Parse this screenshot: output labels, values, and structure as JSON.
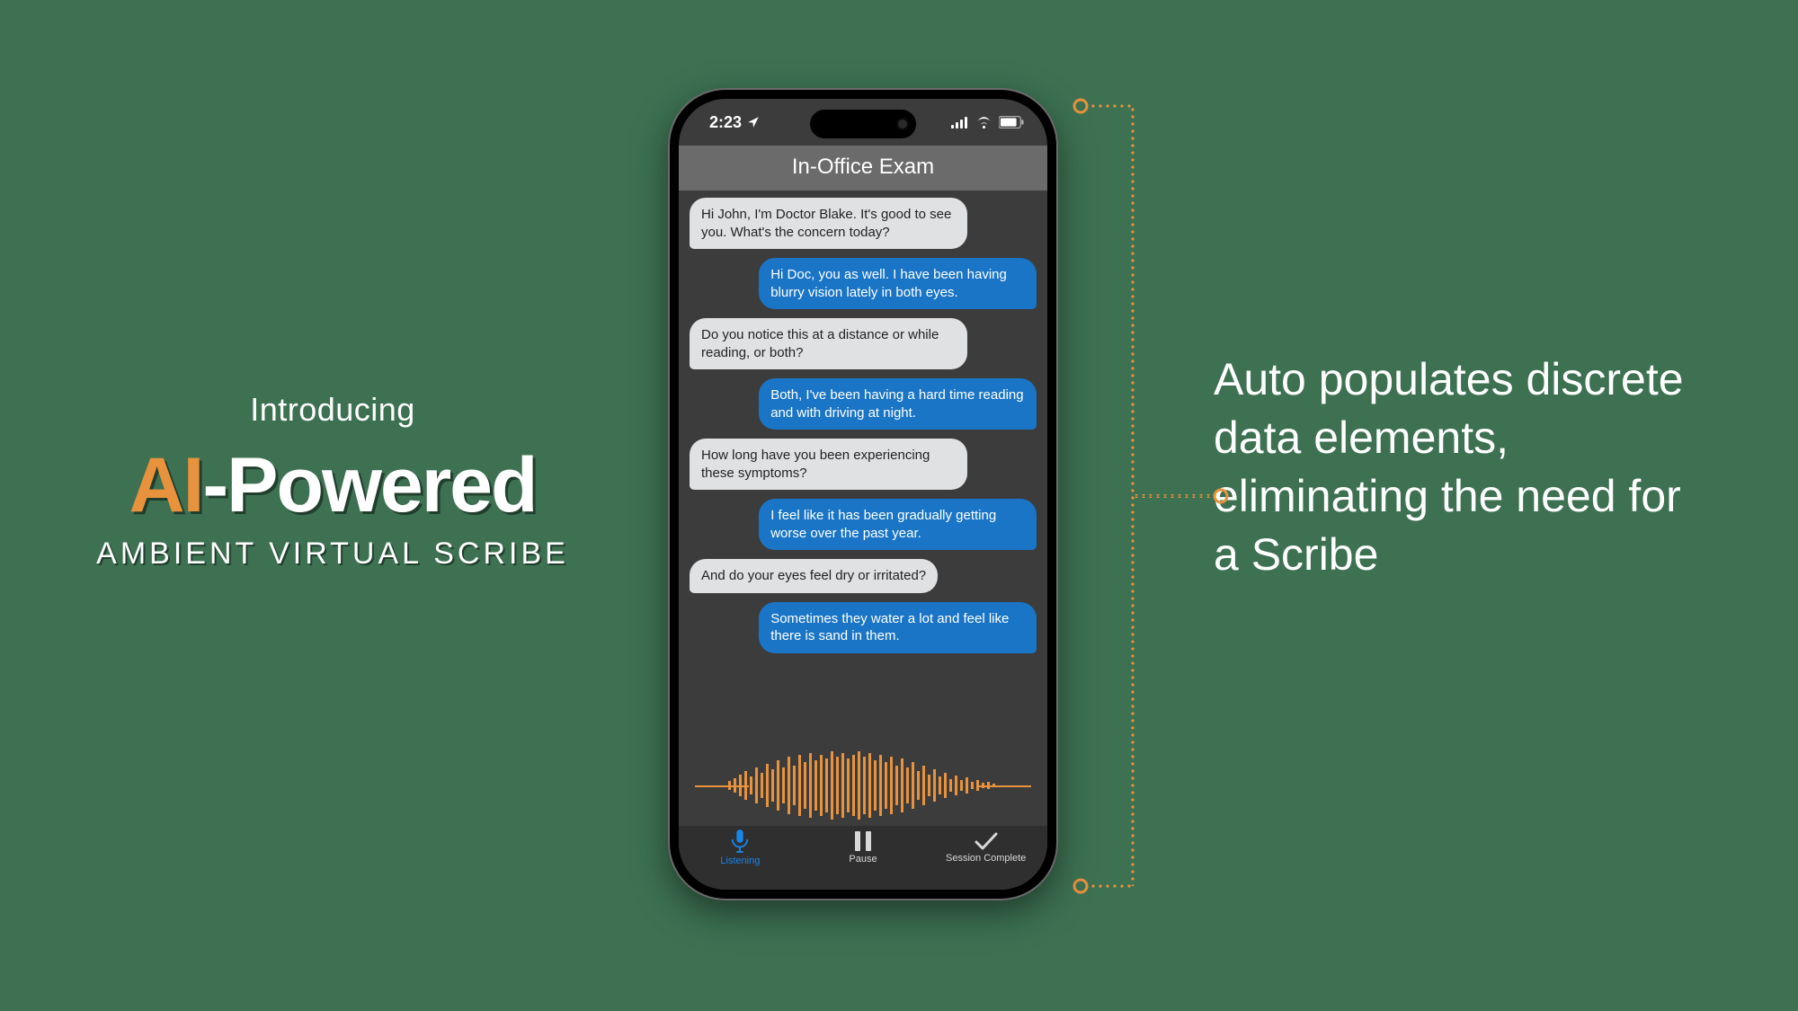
{
  "title": {
    "intro": "Introducing",
    "main_ai": "AI",
    "main_rest": "-Powered",
    "sub": "AMBIENT VIRTUAL SCRIBE"
  },
  "description": "Auto populates discrete data elements, eliminating the need for a Scribe",
  "phone": {
    "status_time": "2:23",
    "header": "In-Office Exam",
    "messages": [
      {
        "role": "doctor",
        "text": "Hi John, I'm Doctor Blake. It's good to see you. What's the concern today?"
      },
      {
        "role": "patient",
        "text": "Hi Doc, you as well. I have been having blurry vision lately in both eyes."
      },
      {
        "role": "doctor",
        "text": "Do you notice this at a distance or while reading, or both?"
      },
      {
        "role": "patient",
        "text": "Both, I've been having a hard time reading and with driving at night."
      },
      {
        "role": "doctor",
        "text": "How long have you been experiencing these symptoms?"
      },
      {
        "role": "patient",
        "text": "I feel like it has been gradually getting worse over the past year."
      },
      {
        "role": "doctor",
        "text": "And do your eyes feel dry or irritated?"
      },
      {
        "role": "patient",
        "text": "Sometimes they water a lot and feel like there is sand in them."
      }
    ],
    "buttons": {
      "listening": "Listening",
      "pause": "Pause",
      "complete": "Session Complete"
    }
  },
  "colors": {
    "accent": "#e8923e",
    "background": "#3d7152",
    "bubble_patient": "#1a75c6"
  }
}
